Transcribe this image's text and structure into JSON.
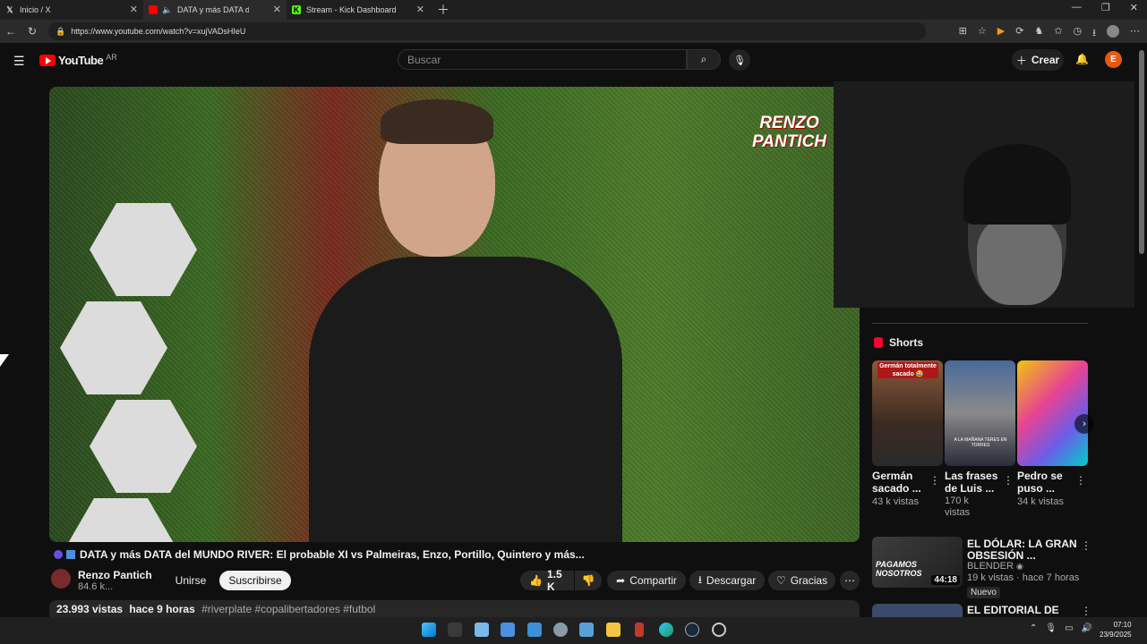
{
  "browser": {
    "tabs": [
      {
        "label": "Inicio / X",
        "icon": "x-logo-icon",
        "active": false
      },
      {
        "label": "DATA y más DATA de",
        "icon": "youtube-icon",
        "active": true
      },
      {
        "label": "Stream - Kick Dashboard",
        "icon": "kick-icon",
        "active": false
      }
    ],
    "url": "https://www.youtube.com/watch?v=xujVADsHIeU"
  },
  "youtube": {
    "logo": "YouTube",
    "country": "AR",
    "search_placeholder": "Buscar",
    "create_label": "Crear",
    "avatar_letter": "E"
  },
  "video": {
    "brand_overlay_line1": "RENZO",
    "brand_overlay_line2": "PANTICH",
    "title": "DATA y más DATA del MUNDO RIVER: El probable XI vs Palmeiras, Enzo, Portillo, Quintero y más...",
    "channel": "Renzo Pantich",
    "subscribers": "84.6 k...",
    "join_label": "Unirse",
    "subscribe_label": "Suscribirse",
    "likes": "1.5 K",
    "share_label": "Compartir",
    "download_label": "Descargar",
    "thanks_label": "Gracias",
    "views": "23.993 vistas",
    "time_ago": "hace 9 horas",
    "tags": "#riverplate #copalibertadores #futbol"
  },
  "sidebar": {
    "shorts_heading": "Shorts",
    "shorts": [
      {
        "title_line1": "Germán",
        "title_line2": "sacado ...",
        "views_line1": "43 k vistas",
        "views_line2": "",
        "overlay": "Germán totalmente sacado 😂"
      },
      {
        "title_line1": "Las frases",
        "title_line2": "de Luis ...",
        "views_line1": "170 k",
        "views_line2": "vistas",
        "overlay": "A LA MAÑANA TERES EN TORRES"
      },
      {
        "title_line1": "Pedro se",
        "title_line2": "puso ...",
        "views_line1": "34 k vistas",
        "views_line2": "",
        "overlay": ""
      }
    ],
    "recommended": [
      {
        "title_line1": "EL DÓLAR: LA GRAN",
        "title_line2": "OBSESIÓN ...",
        "channel": "BLENDER",
        "meta": "19 k vistas · hace 7 horas",
        "badge": "Nuevo",
        "duration": "44:18",
        "thumb_text": "PAGAMOS NOSOTROS"
      },
      {
        "title_line1": "EL EDITORIAL DE"
      }
    ]
  },
  "taskbar": {
    "time": "07:10",
    "date": "23/9/2025"
  }
}
